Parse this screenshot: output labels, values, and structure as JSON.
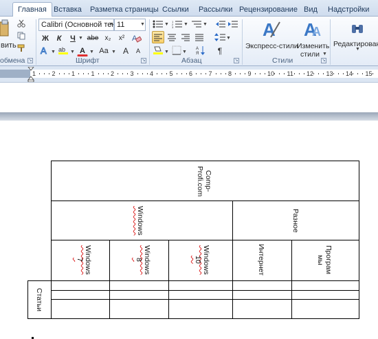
{
  "tabs": [
    "Главная",
    "Вставка",
    "Разметка страницы",
    "Ссылки",
    "Рассылки",
    "Рецензирование",
    "Вид",
    "Надстройки"
  ],
  "ribbon": {
    "clipboard": {
      "paste_label": "вить",
      "group_label": "обмена"
    },
    "font": {
      "font_name": "Calibri (Основной тек",
      "font_size": "11",
      "bold": "Ж",
      "italic": "К",
      "underline": "Ч",
      "strike": "abe",
      "subscript": "x₂",
      "superscript": "x²",
      "font_color_glyph": "A",
      "change_case": "Aa",
      "grow": "A",
      "shrink": "A",
      "group_label": "Шрифт"
    },
    "paragraph": {
      "group_label": "Абзац"
    },
    "styles": {
      "express_label": "Экспресс-стили",
      "change_label_1": "Изменить",
      "change_label_2": "стили",
      "group_label": "Стили"
    },
    "editing": {
      "label": "Редактирование"
    }
  },
  "ruler": {
    "numbers": [
      "1",
      "2",
      "1",
      "1",
      "2",
      "3",
      "4",
      "5",
      "6",
      "7",
      "8",
      "9",
      "10",
      "11",
      "12",
      "13",
      "14",
      "15",
      "16",
      "17"
    ]
  },
  "table": {
    "header_site": "Comp-\nProfi.com",
    "group_windows": "Windows",
    "group_misc": "Разное",
    "col_win7": "Windows\n7",
    "col_win8": "Windows\n8",
    "col_win10": "Windows\n10",
    "col_internet": "Интернет",
    "col_programs": "Програм\nмы",
    "row_articles": "Статьи"
  },
  "colors": {
    "ribbon_bg": "#e4ecf7",
    "tab_text": "#1e395b",
    "active_button": "#f8cf6a",
    "spell_underline": "#d22"
  }
}
